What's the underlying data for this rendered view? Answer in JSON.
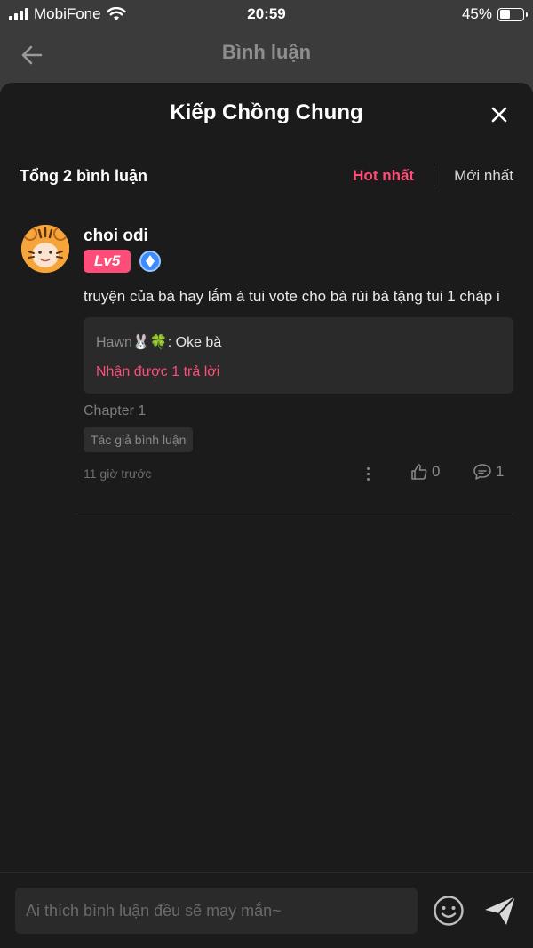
{
  "status_bar": {
    "carrier": "MobiFone",
    "time": "20:59",
    "battery": "45%",
    "battery_level": 0.45
  },
  "nav": {
    "title": "Bình luận"
  },
  "sheet": {
    "title": "Kiếp Chồng Chung",
    "total": "Tổng 2 bình luận",
    "sort_tabs": [
      {
        "label": "Hot nhất",
        "active": true
      },
      {
        "label": "Mới nhất",
        "active": false
      }
    ]
  },
  "comment": {
    "username": "choi odi",
    "level": "Lv5",
    "text": "truyện của bà hay lắm á tui vote cho bà rùi bà tặng tui 1 cháp i",
    "reply": {
      "author": "Hawn🐰🍀",
      "separator": ": ",
      "text": "Oke bà",
      "reply_count": "Nhận được 1 trả lời"
    },
    "chapter": "Chapter 1",
    "author_tag": "Tác giả bình luận",
    "time": "11 giờ trước",
    "likes": "0",
    "replies": "1"
  },
  "input": {
    "placeholder": "Ai thích bình luận đều sẽ may mắn~"
  },
  "colors": {
    "accent": "#ff4d79",
    "sheet_bg": "#1b1b1b",
    "page_bg": "#3b3b3b"
  }
}
